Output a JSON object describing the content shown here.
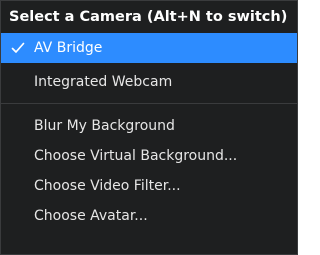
{
  "menu": {
    "header": "Select a Camera (Alt+N to switch)",
    "cameras": [
      {
        "label": "AV Bridge",
        "selected": true,
        "check_icon": "checkmark-icon"
      },
      {
        "label": "Integrated Webcam",
        "selected": false
      }
    ],
    "options": [
      {
        "label": "Blur My Background"
      },
      {
        "label": "Choose Virtual Background..."
      },
      {
        "label": "Choose Video Filter..."
      },
      {
        "label": "Choose Avatar..."
      }
    ]
  },
  "colors": {
    "menu_background": "#1e1f20",
    "selected_background": "#2d8cff",
    "text": "#e6e6e6",
    "separator": "#3a3b3d"
  }
}
